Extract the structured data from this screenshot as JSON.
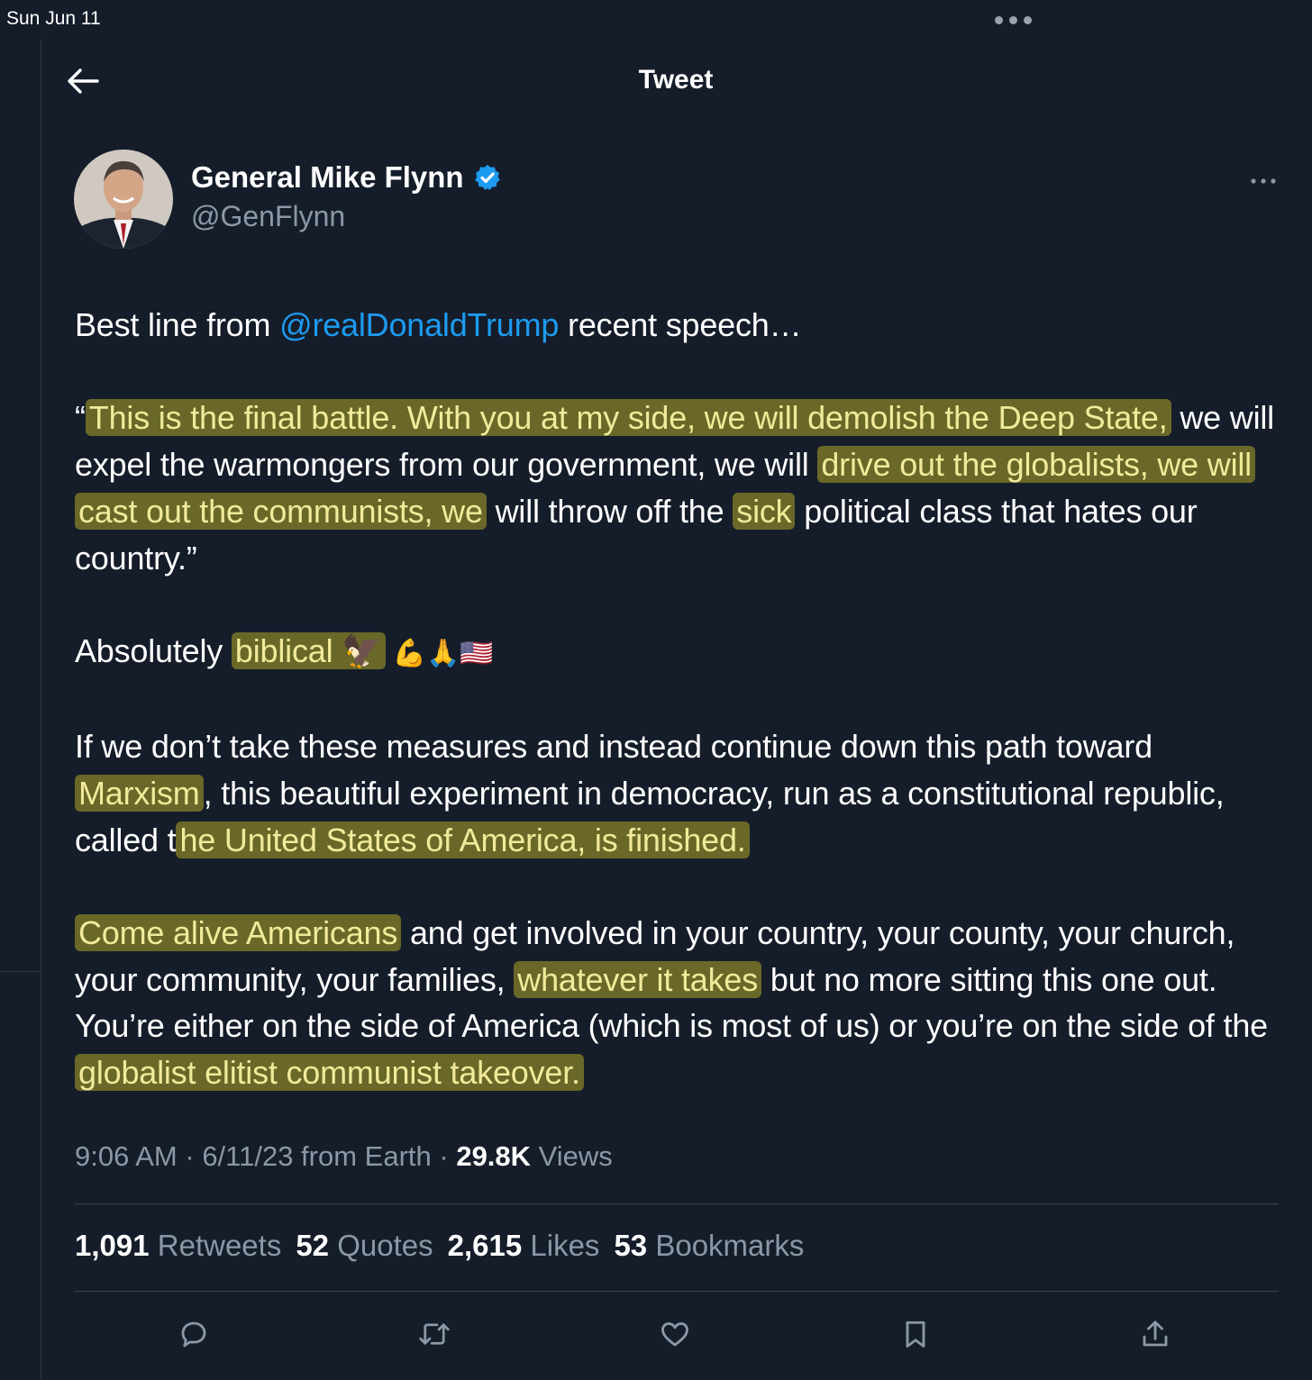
{
  "status_bar": {
    "time": "Sun Jun 11"
  },
  "header": {
    "title": "Tweet"
  },
  "author": {
    "name": "General Mike Flynn",
    "handle": "@GenFlynn"
  },
  "tweet": {
    "p1_before": "Best line from ",
    "mention": "@realDonaldTrump",
    "p1_after": "  recent speech…",
    "q_1": "“",
    "q_2": "This is the final battle. With you at my side, we will demolish the Deep State,",
    "q_3": " we will expel the warmongers from our government, we will ",
    "q_4": "drive out the globalists, we will cast out the communists, we",
    "q_5": " will throw off the ",
    "q_6": "sick",
    "q_7": " political class that hates our country.”",
    "a_1": "Absolutely ",
    "a_2": "biblical 🦅",
    "a_3": " 💪🙏🇺🇸",
    "b_1": "If we don’t take these measures and instead continue down this path toward ",
    "b_2": "Marxism",
    "b_3": ", this beautiful experiment in democracy, run as a constitutional republic, called t",
    "b_4": "he United States of America, is finished.",
    "c_1": "Come alive Americans",
    "c_2": " and get involved in your country, your county, your church, your community, your families, ",
    "c_3": "whatever it takes",
    "c_4": " but no more sitting this one out. You’re either on the side of America (which is most of us) or you’re on the side of the ",
    "c_5": "globalist elitist communist takeover."
  },
  "meta": {
    "time": "9:06 AM",
    "sep1": " · ",
    "date_source": "6/11/23 from Earth",
    "sep2": " · ",
    "views_count": "29.8K",
    "views_label": " Views"
  },
  "stats": {
    "retweets_count": "1,091",
    "retweets_label": "Retweets",
    "quotes_count": "52",
    "quotes_label": "Quotes",
    "likes_count": "2,615",
    "likes_label": "Likes",
    "bookmarks_count": "53",
    "bookmarks_label": "Bookmarks"
  },
  "icons": {
    "back": "arrow-left-icon",
    "verified": "verified-badge-icon",
    "more": "ellipsis-icon",
    "reply": "reply-icon",
    "retweet": "retweet-icon",
    "like": "heart-icon",
    "bookmark": "bookmark-icon",
    "share": "share-icon"
  },
  "colors": {
    "background": "#151d2a",
    "mention": "#1d9bf0",
    "verified": "#1d9bf0",
    "highlight": "#bdb426",
    "muted": "#8b98a5"
  }
}
